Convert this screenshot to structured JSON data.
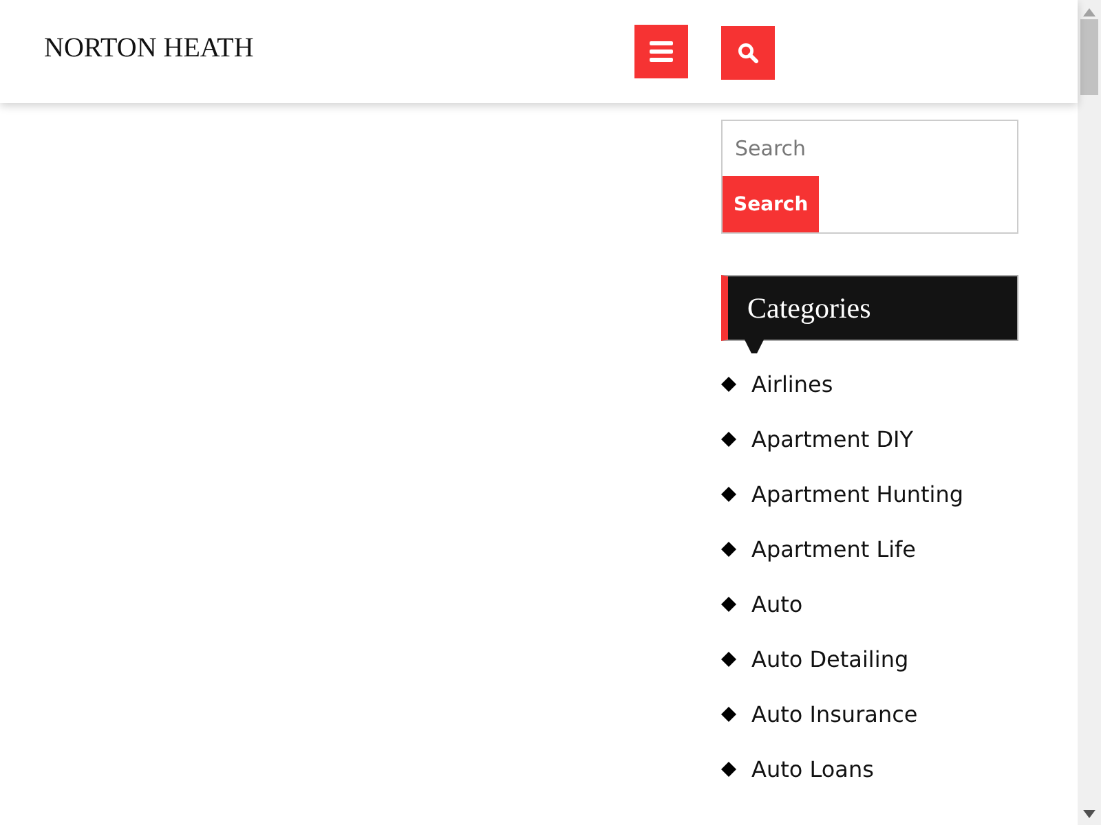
{
  "header": {
    "site_title": "NORTON HEATH"
  },
  "search": {
    "placeholder": "Search",
    "button": "Search"
  },
  "categories": {
    "title": "Categories",
    "items": [
      {
        "label": "Airlines"
      },
      {
        "label": "Apartment DIY"
      },
      {
        "label": "Apartment Hunting"
      },
      {
        "label": "Apartment Life"
      },
      {
        "label": "Auto"
      },
      {
        "label": "Auto Detailing"
      },
      {
        "label": "Auto Insurance"
      },
      {
        "label": "Auto Loans"
      }
    ]
  }
}
